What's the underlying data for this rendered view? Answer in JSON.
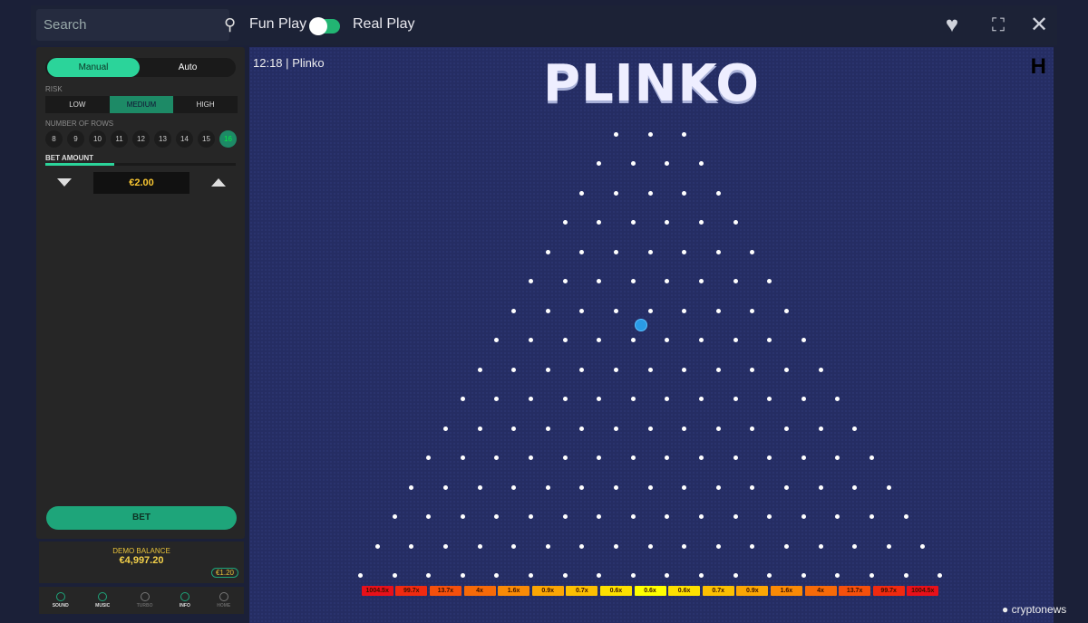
{
  "search": {
    "placeholder": "Search"
  },
  "header": {
    "fun_play": "Fun Play",
    "real_play": "Real Play",
    "mode_toggle_on": "fun"
  },
  "sidebar": {
    "modes": [
      "Manual",
      "Auto"
    ],
    "risk_label": "RISK",
    "risk": [
      "LOW",
      "MEDIUM",
      "HIGH"
    ],
    "risk_selected": "MEDIUM",
    "rows_label": "NUMBER OF ROWS",
    "rows": [
      "8",
      "9",
      "10",
      "11",
      "12",
      "13",
      "14",
      "15",
      "16"
    ],
    "rows_selected": "16",
    "bet_label": "BET AMOUNT",
    "bet_value": "€2.00",
    "bet_slider_percent": 36,
    "bet_button": "BET",
    "balance_label": "DEMO BALANCE",
    "balance": "€4,997.20",
    "last_win": "€1.20",
    "bottom": [
      {
        "label": "SOUND",
        "icon": "sound-icon",
        "active": true
      },
      {
        "label": "MUSIC",
        "icon": "music-icon",
        "active": true
      },
      {
        "label": "TURBO",
        "icon": "turbo-icon",
        "active": false
      },
      {
        "label": "INFO",
        "icon": "info-icon",
        "active": true
      },
      {
        "label": "HOME",
        "icon": "home-icon",
        "active": false
      }
    ]
  },
  "game": {
    "clock": "12:18",
    "separator": "|",
    "name": "Plinko",
    "logo": "PLINKO",
    "rows": 16,
    "multipliers": [
      "1004.5x",
      "99.7x",
      "13.7x",
      "4x",
      "1.6x",
      "0.9x",
      "0.7x",
      "0.6x",
      "0.6x",
      "0.6x",
      "0.7x",
      "0.9x",
      "1.6x",
      "4x",
      "13.7x",
      "99.7x",
      "1004.5x"
    ],
    "bucket_colors": [
      "#e8101a",
      "#f02a10",
      "#f5500c",
      "#f76a08",
      "#f98a06",
      "#fba604",
      "#fcc002",
      "#fde000",
      "#ffff00"
    ]
  },
  "watermark": "cryptonews"
}
